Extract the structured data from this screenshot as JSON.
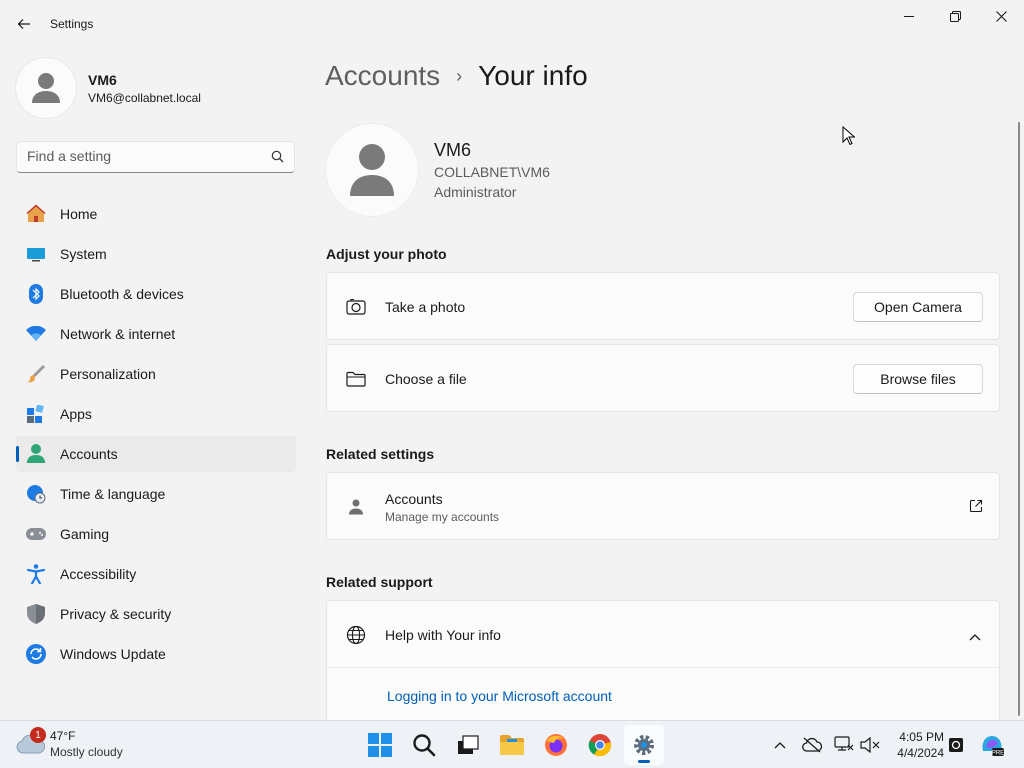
{
  "window": {
    "title": "Settings"
  },
  "profile": {
    "name": "VM6",
    "email": "VM6@collabnet.local"
  },
  "search": {
    "placeholder": "Find a setting"
  },
  "nav": {
    "items": [
      {
        "label": "Home",
        "icon": "home-icon"
      },
      {
        "label": "System",
        "icon": "system-icon"
      },
      {
        "label": "Bluetooth & devices",
        "icon": "bluetooth-icon"
      },
      {
        "label": "Network & internet",
        "icon": "wifi-icon"
      },
      {
        "label": "Personalization",
        "icon": "brush-icon"
      },
      {
        "label": "Apps",
        "icon": "apps-icon"
      },
      {
        "label": "Accounts",
        "icon": "accounts-icon",
        "active": true
      },
      {
        "label": "Time & language",
        "icon": "globe-clock-icon"
      },
      {
        "label": "Gaming",
        "icon": "gamepad-icon"
      },
      {
        "label": "Accessibility",
        "icon": "accessibility-icon"
      },
      {
        "label": "Privacy & security",
        "icon": "shield-icon"
      },
      {
        "label": "Windows Update",
        "icon": "update-icon"
      }
    ]
  },
  "breadcrumb": {
    "parent": "Accounts",
    "separator": "›",
    "current": "Your info"
  },
  "user": {
    "name": "VM6",
    "domain": "COLLABNET\\VM6",
    "role": "Administrator"
  },
  "adjust_photo": {
    "title": "Adjust your photo",
    "take_photo": {
      "label": "Take a photo",
      "button": "Open Camera"
    },
    "choose_file": {
      "label": "Choose a file",
      "button": "Browse files"
    }
  },
  "related_settings": {
    "title": "Related settings",
    "accounts": {
      "label": "Accounts",
      "sub": "Manage my accounts"
    }
  },
  "related_support": {
    "title": "Related support",
    "help": {
      "label": "Help with Your info",
      "link": "Logging in to your Microsoft account"
    }
  },
  "taskbar": {
    "weather": {
      "badge": "1",
      "temp": "47°F",
      "condition": "Mostly cloudy"
    },
    "clock": {
      "time": "4:05 PM",
      "date": "4/4/2024"
    }
  },
  "colors": {
    "accent": "#005fb8",
    "background": "#f3f3f3",
    "card": "#fbfbfb"
  }
}
